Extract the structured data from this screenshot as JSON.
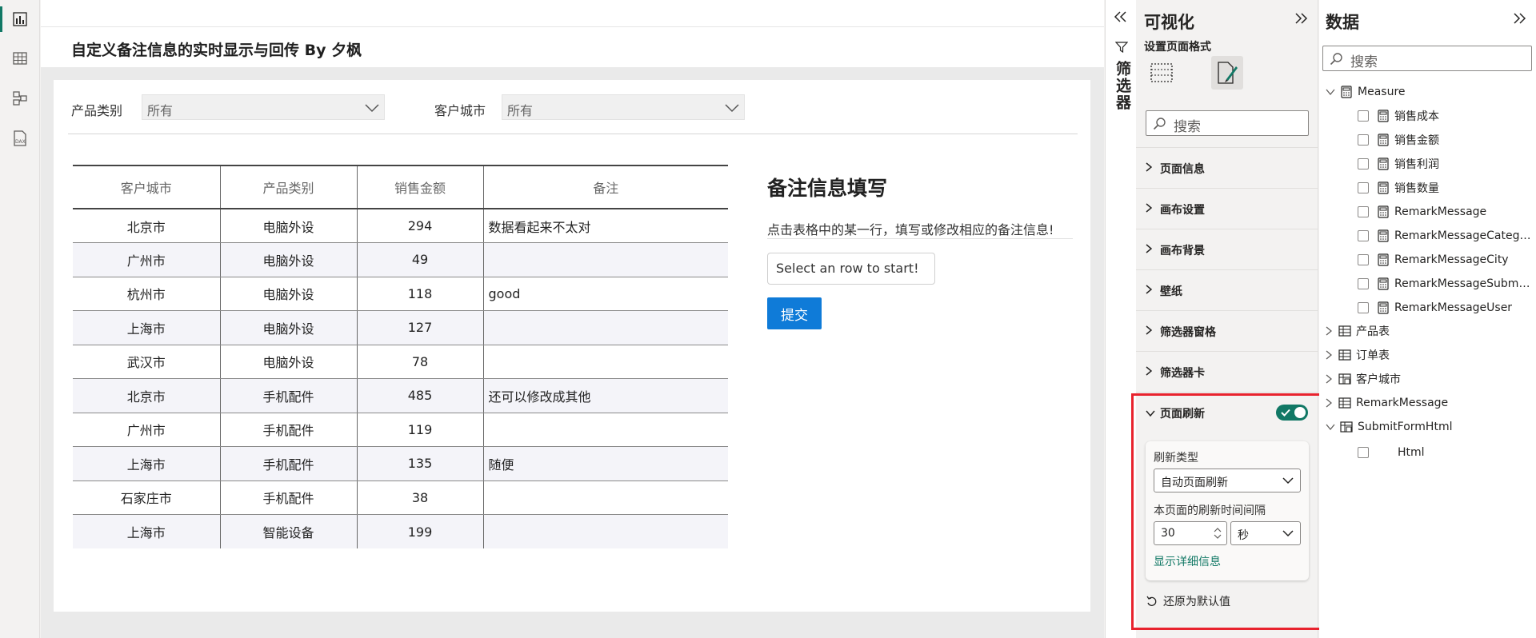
{
  "report": {
    "title": "自定义备注信息的实时显示与回传 By 夕枫",
    "slicers": [
      {
        "label": "产品类别",
        "value": "所有"
      },
      {
        "label": "客户城市",
        "value": "所有"
      }
    ],
    "table": {
      "headers": [
        "客户城市",
        "产品类别",
        "销售金额",
        "备注"
      ],
      "rows": [
        {
          "city": "北京市",
          "category": "电脑外设",
          "amount": "294",
          "note": "数据看起来不太对"
        },
        {
          "city": "广州市",
          "category": "电脑外设",
          "amount": "49",
          "note": ""
        },
        {
          "city": "杭州市",
          "category": "电脑外设",
          "amount": "118",
          "note": "good"
        },
        {
          "city": "上海市",
          "category": "电脑外设",
          "amount": "127",
          "note": ""
        },
        {
          "city": "武汉市",
          "category": "电脑外设",
          "amount": "78",
          "note": ""
        },
        {
          "city": "北京市",
          "category": "手机配件",
          "amount": "485",
          "note": "还可以修改成其他"
        },
        {
          "city": "广州市",
          "category": "手机配件",
          "amount": "119",
          "note": ""
        },
        {
          "city": "上海市",
          "category": "手机配件",
          "amount": "135",
          "note": "随便"
        },
        {
          "city": "石家庄市",
          "category": "手机配件",
          "amount": "38",
          "note": ""
        },
        {
          "city": "上海市",
          "category": "智能设备",
          "amount": "199",
          "note": ""
        }
      ]
    },
    "form": {
      "title": "备注信息填写",
      "hint": "点击表格中的某一行，填写或修改相应的备注信息!",
      "input_value": "Select an row to start!",
      "submit_label": "提交"
    }
  },
  "filter_pane": {
    "label": "筛选器"
  },
  "viz_pane": {
    "title": "可视化",
    "subtitle": "设置页面格式",
    "search_placeholder": "搜索",
    "sections": [
      "页面信息",
      "画布设置",
      "画布背景",
      "壁纸",
      "筛选器窗格",
      "筛选器卡"
    ],
    "page_refresh": {
      "label": "页面刷新",
      "enabled": true,
      "type_label": "刷新类型",
      "type_value": "自动页面刷新",
      "interval_label": "本页面的刷新时间间隔",
      "interval_value": "30",
      "unit_value": "秒",
      "details_link": "显示详细信息",
      "reset_label": "还原为默认值"
    }
  },
  "data_pane": {
    "title": "数据",
    "search_placeholder": "搜索",
    "measure_table": "Measure",
    "measures": [
      "销售成本",
      "销售金额",
      "销售利润",
      "销售数量",
      "RemarkMessage",
      "RemarkMessageCategory",
      "RemarkMessageCity",
      "RemarkMessageSubmit...",
      "RemarkMessageUser"
    ],
    "tables": [
      "产品表",
      "订单表",
      "客户城市",
      "RemarkMessage"
    ],
    "submit_table": "SubmitFormHtml",
    "submit_fields": [
      "Html"
    ]
  },
  "colors": {
    "accent": "#117865",
    "button_blue": "#0f7bd8",
    "highlight_red": "#e8232e"
  }
}
